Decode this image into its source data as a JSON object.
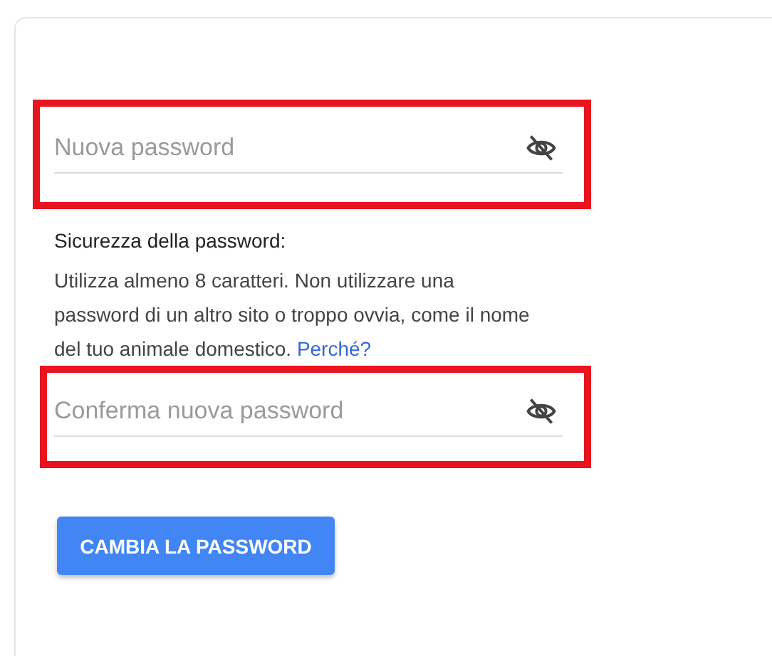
{
  "fields": [
    {
      "placeholder": "Nuova password",
      "highlighted": true
    },
    {
      "placeholder": "Conferma nuova password",
      "highlighted": true
    }
  ],
  "strength": {
    "heading": "Sicurezza della password:",
    "text": "Utilizza almeno 8 caratteri. Non utilizzare una password di un altro sito o troppo ovvia, come il nome del tuo animale domestico.",
    "link": "Perché?"
  },
  "button": "CAMBIA LA PASSWORD"
}
